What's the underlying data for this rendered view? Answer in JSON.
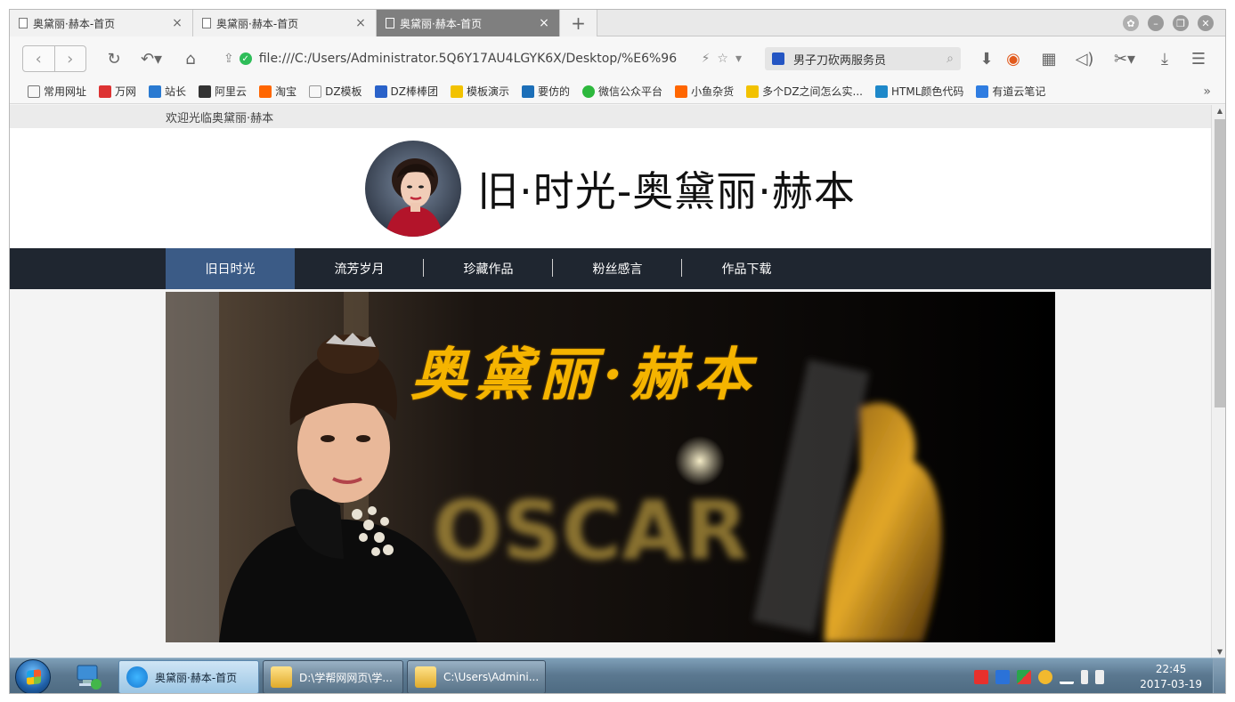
{
  "browser": {
    "tabs": [
      {
        "title": "奥黛丽·赫本-首页",
        "active": false
      },
      {
        "title": "奥黛丽·赫本-首页",
        "active": false
      },
      {
        "title": "奥黛丽·赫本-首页",
        "active": true
      }
    ],
    "new_tab_label": "+",
    "close_label": "×",
    "address_url": "file:///C:/Users/Administrator.5Q6Y17AU4LGYK6X/Desktop/%E6%96",
    "search_query": "男子刀砍两服务员",
    "bookmarks": [
      "常用网址",
      "万网",
      "站长",
      "阿里云",
      "淘宝",
      "DZ模板",
      "DZ棒棒团",
      "模板演示",
      "要仿的",
      "微信公众平台",
      "小鱼杂货",
      "多个DZ之间怎么实...",
      "HTML颜色代码",
      "有道云笔记"
    ],
    "bookmark_more": "»"
  },
  "page": {
    "welcome": "欢迎光临奥黛丽·赫本",
    "site_title": "旧·时光-奥黛丽·赫本",
    "nav": [
      {
        "label": "旧日时光",
        "active": true
      },
      {
        "label": "流芳岁月",
        "active": false
      },
      {
        "label": "珍藏作品",
        "active": false
      },
      {
        "label": "粉丝感言",
        "active": false
      },
      {
        "label": "作品下载",
        "active": false
      }
    ],
    "banner": {
      "headline": "奥黛丽·赫本"
    }
  },
  "taskbar": {
    "buttons": [
      {
        "label": "奥黛丽·赫本-首页",
        "active": true
      },
      {
        "label": "D:\\学帮网网页\\学...",
        "active": false
      },
      {
        "label": "C:\\Users\\Admini...",
        "active": false
      }
    ],
    "clock_time": "22:45",
    "clock_date": "2017-03-19"
  },
  "colors": {
    "nav_bg": "#1f2630",
    "nav_active": "#3b5b86",
    "banner_title": "#f5b400"
  },
  "icons": [
    "back-icon",
    "forward-icon",
    "refresh-icon",
    "undo-icon",
    "home-icon",
    "shield-icon",
    "star-icon",
    "search-icon",
    "menu-icon"
  ]
}
